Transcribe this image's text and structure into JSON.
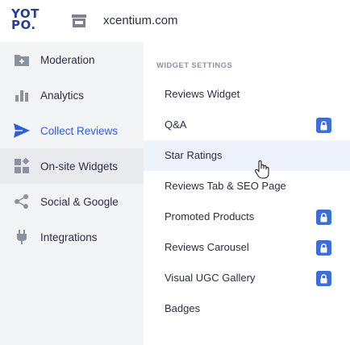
{
  "brand": {
    "logo_line1": "YOT",
    "logo_line2": "PO."
  },
  "store": {
    "name": "xcentium.com",
    "icon": "store-icon"
  },
  "colors": {
    "accent": "#2e5ed8",
    "logo": "#2c3e93",
    "lock": "#3b6fd6",
    "sidebar_bg": "#f3f4f6",
    "hover_bg": "#eef3fb"
  },
  "sidebar": {
    "items": [
      {
        "label": "Moderation",
        "icon": "moderation-icon"
      },
      {
        "label": "Analytics",
        "icon": "analytics-icon"
      },
      {
        "label": "Collect Reviews",
        "icon": "send-icon"
      },
      {
        "label": "On-site Widgets",
        "icon": "widgets-icon"
      },
      {
        "label": "Social & Google",
        "icon": "share-icon"
      },
      {
        "label": "Integrations",
        "icon": "plug-icon"
      }
    ]
  },
  "widget_menu": {
    "heading": "WIDGET SETTINGS",
    "items": [
      {
        "label": "Reviews Widget",
        "locked": false
      },
      {
        "label": "Q&A",
        "locked": true
      },
      {
        "label": "Star Ratings",
        "locked": false
      },
      {
        "label": "Reviews Tab & SEO Page",
        "locked": false
      },
      {
        "label": "Promoted Products",
        "locked": true
      },
      {
        "label": "Reviews Carousel",
        "locked": true
      },
      {
        "label": "Visual UGC Gallery",
        "locked": true
      },
      {
        "label": "Badges",
        "locked": false
      }
    ]
  }
}
